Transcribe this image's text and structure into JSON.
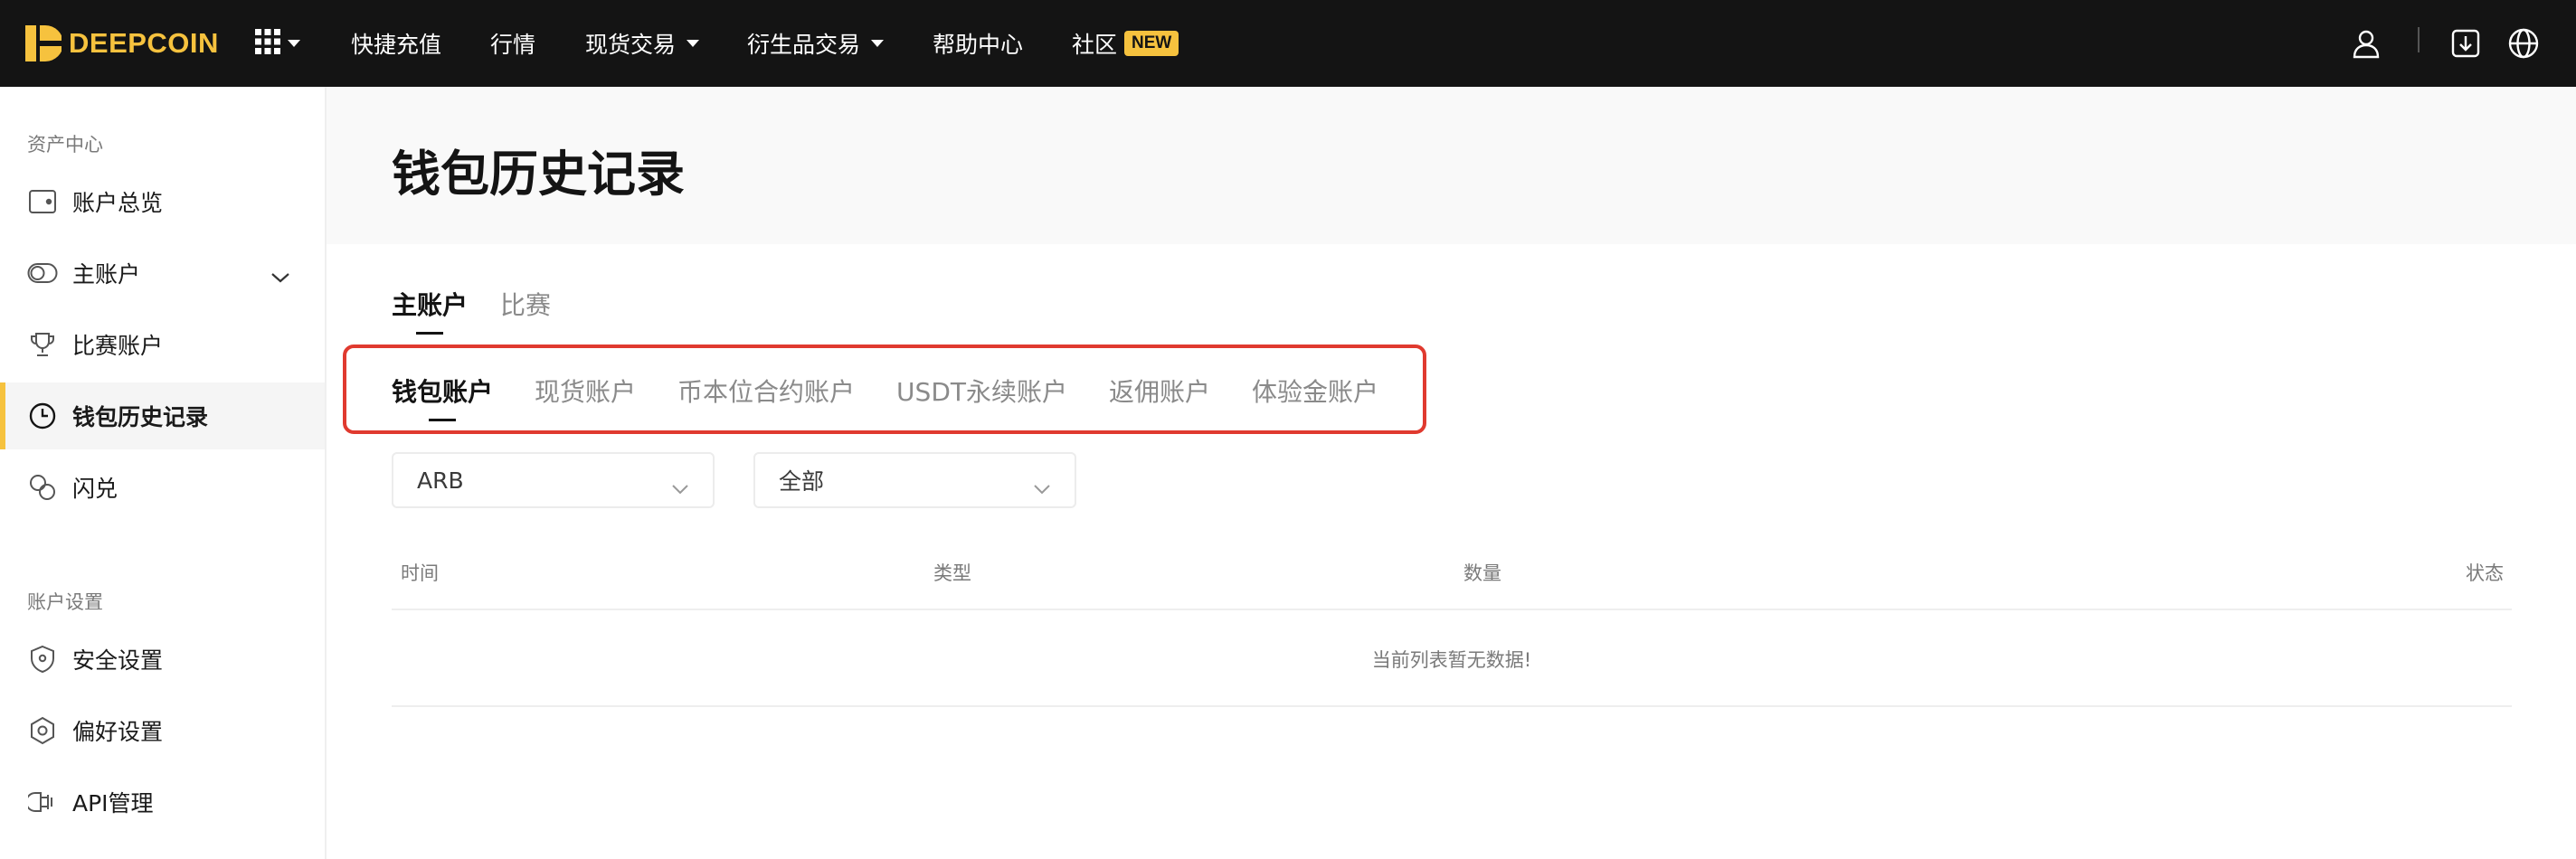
{
  "brand": {
    "name": "DEEPCOIN",
    "color": "#f6c23e"
  },
  "topnav": {
    "apps_icon": "grid-icon",
    "items": [
      {
        "label": "快捷充值"
      },
      {
        "label": "行情"
      },
      {
        "label": "现货交易"
      },
      {
        "label": "衍生品交易"
      },
      {
        "label": "帮助中心"
      },
      {
        "label": "社区",
        "badge": "NEW"
      }
    ],
    "right_icons": [
      "user-icon",
      "download-icon",
      "globe-icon"
    ]
  },
  "sidebar": {
    "sections": [
      {
        "title": "资产中心"
      },
      {
        "title": "账户设置"
      }
    ],
    "items": [
      {
        "label": "账户总览",
        "icon": "wallet-icon"
      },
      {
        "label": "主账户",
        "icon": "toggle-icon",
        "expandable": true
      },
      {
        "label": "比赛账户",
        "icon": "trophy-icon"
      },
      {
        "label": "钱包历史记录",
        "icon": "clock-icon",
        "active": true
      },
      {
        "label": "闪兑",
        "icon": "swap-icon"
      },
      {
        "label": "安全设置",
        "icon": "shield-icon"
      },
      {
        "label": "偏好设置",
        "icon": "hexagon-settings-icon"
      },
      {
        "label": "API管理",
        "icon": "api-icon"
      }
    ]
  },
  "page": {
    "title": "钱包历史记录"
  },
  "account_tabs": [
    {
      "label": "主账户",
      "active": true
    },
    {
      "label": "比赛",
      "active": false
    }
  ],
  "wallet_tabs": [
    {
      "label": "钱包账户",
      "active": true
    },
    {
      "label": "现货账户",
      "active": false
    },
    {
      "label": "币本位合约账户",
      "active": false
    },
    {
      "label": "USDT永续账户",
      "active": false
    },
    {
      "label": "返佣账户",
      "active": false
    },
    {
      "label": "体验金账户",
      "active": false
    }
  ],
  "filters": {
    "coin": {
      "value": "ARB"
    },
    "type": {
      "value": "全部"
    }
  },
  "table": {
    "columns": [
      "时间",
      "类型",
      "数量",
      "状态"
    ],
    "rows": [],
    "empty_text": "当前列表暂无数据!"
  },
  "colors": {
    "accent": "#f6c23e",
    "highlight": "#e03a2f",
    "topbar": "#141414"
  }
}
